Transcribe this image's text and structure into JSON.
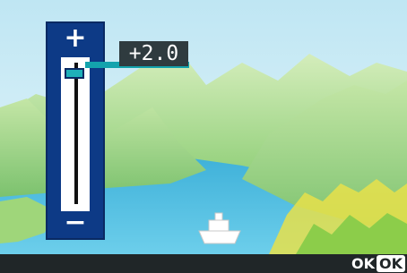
{
  "exposure": {
    "plus_label": "+",
    "minus_label": "−",
    "value_label": "+2.0",
    "level_fraction": 0.95
  },
  "bottom_bar": {
    "ok_text": "OK",
    "ok_key_label": "OK"
  },
  "colors": {
    "panel": "#0d3a86",
    "accent": "#13a3ad",
    "value_bg": "#2f3b3f",
    "bar_bg": "#202628"
  }
}
